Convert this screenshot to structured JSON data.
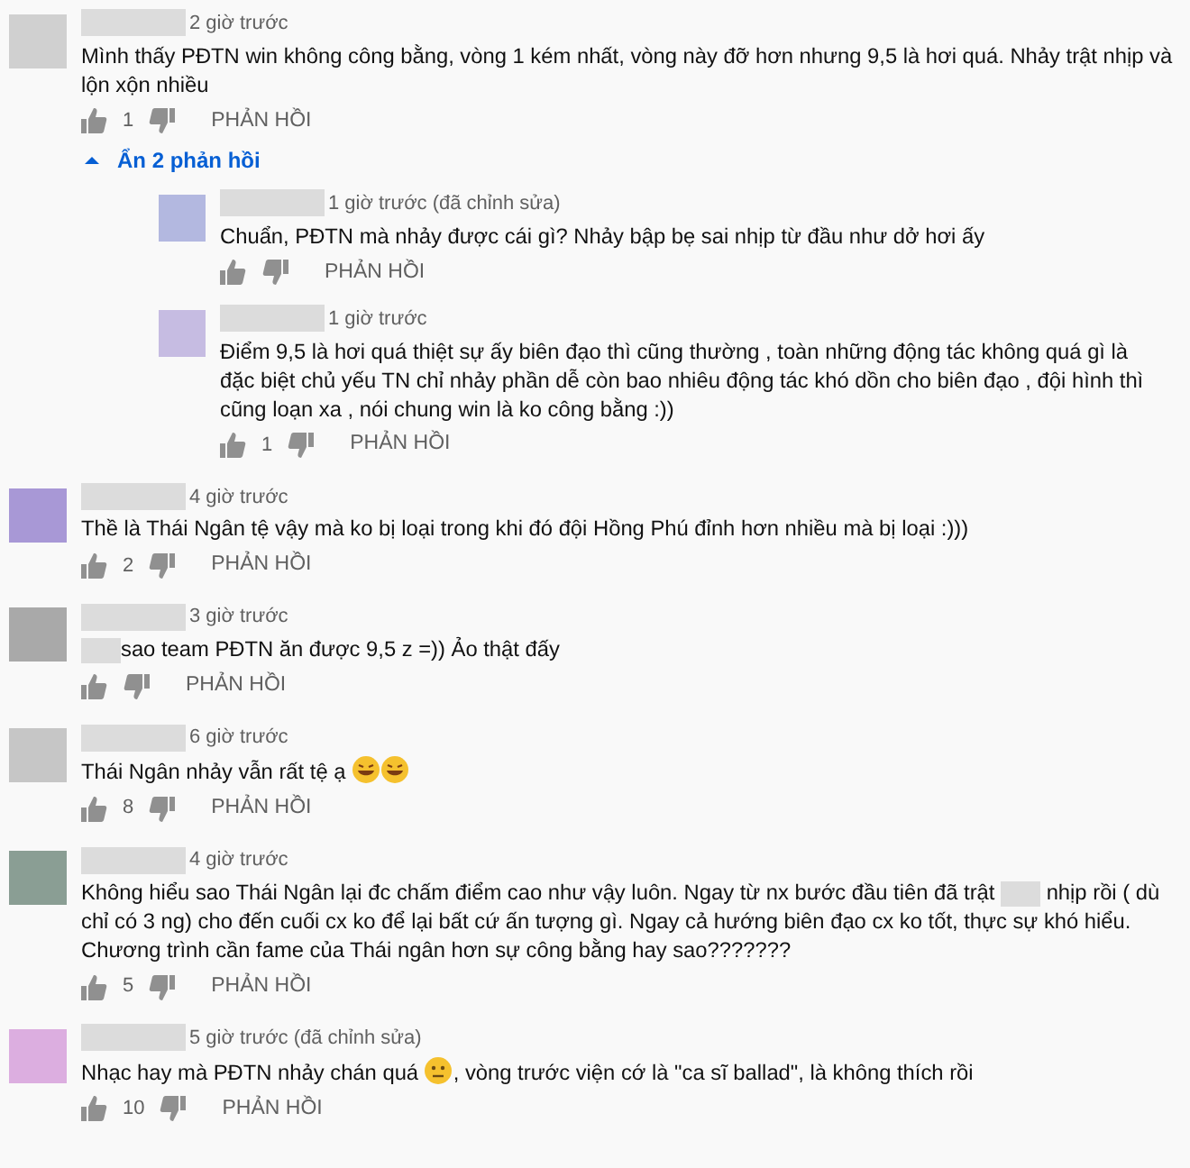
{
  "comments": [
    {
      "color": "#d0d0d0",
      "time": "2 giờ trước",
      "parts": [
        {
          "kind": "text",
          "text": "Mình thấy PĐTN win không công bằng, vòng 1 kém nhất, vòng này đỡ hơn nhưng 9,5 là hơi quá. Nhảy trật nhịp và lộn xộn nhiều"
        }
      ],
      "likes": "1",
      "reply_label": "PHẢN HỒI",
      "replies_toggle": {
        "label": "Ẩn 2 phản hồi",
        "expanded": true
      },
      "replies": [
        {
          "color": "#b3b8e0",
          "time": "1 giờ trước (đã chỉnh sửa)",
          "parts": [
            {
              "kind": "text",
              "text": "Chuẩn, PĐTN mà nhảy được cái gì? Nhảy bập bẹ sai nhịp từ đầu như dở hơi ấy"
            }
          ],
          "reply_label": "PHẢN HỒI"
        },
        {
          "color": "#c6bce2",
          "time": "1 giờ trước",
          "parts": [
            {
              "kind": "text",
              "text": "Điểm 9,5 là hơi quá thiệt sự ấy biên đạo thì cũng thường , toàn những động tác không quá gì là đặc biệt chủ yếu TN chỉ nhảy phần dễ còn bao nhiêu động tác khó dồn cho biên đạo , đội hình thì cũng loạn xa , nói chung win là ko công bằng :))"
            }
          ],
          "likes": "1",
          "reply_label": "PHẢN HỒI"
        }
      ]
    },
    {
      "color": "#a898d6",
      "time": "4 giờ trước",
      "parts": [
        {
          "kind": "text",
          "text": "Thề là Thái Ngân tệ vậy mà ko bị loại trong khi đó đội Hồng Phú đỉnh hơn nhiều mà bị loại :)))"
        }
      ],
      "likes": "2",
      "reply_label": "PHẢN HỒI"
    },
    {
      "color": "#a9a9a9",
      "time": "3 giờ trước",
      "parts": [
        {
          "kind": "redaction"
        },
        {
          "kind": "text",
          "text": "sao team PĐTN ăn được 9,5 z =)) Ảo thật đấy"
        }
      ],
      "reply_label": "PHẢN HỒI"
    },
    {
      "color": "#c6c6c6",
      "time": "6 giờ trước",
      "parts": [
        {
          "kind": "text",
          "text": "Thái Ngân nhảy vẫn rất tệ ạ "
        },
        {
          "kind": "laugh"
        },
        {
          "kind": "laugh"
        }
      ],
      "likes": "8",
      "reply_label": "PHẢN HỒI"
    },
    {
      "color": "#8a9e94",
      "time": "4 giờ trước",
      "parts": [
        {
          "kind": "text",
          "text": "Không hiểu sao Thái Ngân lại đc chấm điểm cao như vậy luôn. Ngay từ nx bước đầu tiên đã trật "
        },
        {
          "kind": "redaction"
        },
        {
          "kind": "text",
          "text": " nhịp rồi ( dù chỉ có 3 ng) cho đến cuối cx ko để lại bất cứ ấn tượng gì. Ngay cả hướng biên đạo cx ko tốt, thực sự khó hiểu. Chương trình cần fame của Thái ngân hơn sự công bằng hay sao???????"
        }
      ],
      "likes": "5",
      "reply_label": "PHẢN HỒI"
    },
    {
      "color": "#dcaee0",
      "time": "5 giờ trước (đã chỉnh sửa)",
      "parts": [
        {
          "kind": "text",
          "text": "Nhạc hay mà PĐTN nhảy chán quá "
        },
        {
          "kind": "neutral"
        },
        {
          "kind": "text",
          "text": ", vòng trước viện cớ là \"ca sĩ ballad\", là không thích rồi"
        }
      ],
      "likes": "10",
      "reply_label": "PHẢN HỒI"
    }
  ]
}
